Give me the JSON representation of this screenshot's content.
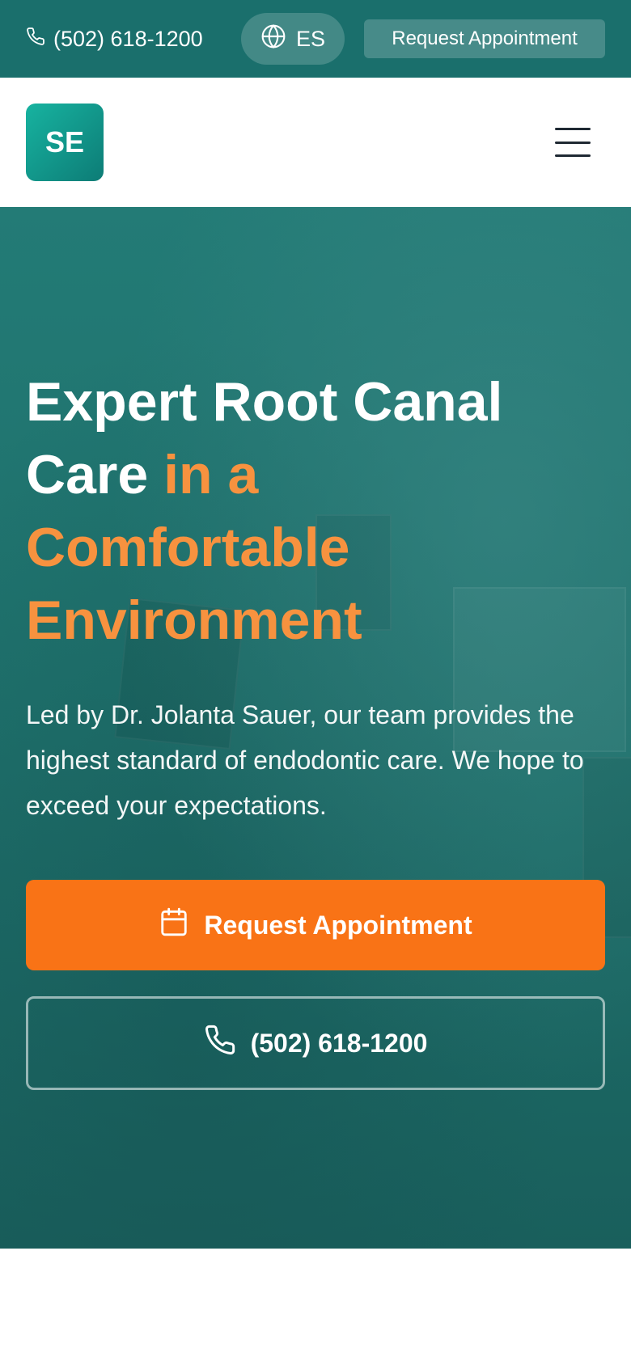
{
  "topbar": {
    "phone": "(502) 618-1200",
    "language_label": "ES",
    "cta_label": "Request Appointment"
  },
  "header": {
    "logo_text": "SE"
  },
  "hero": {
    "title_main": "Expert Root Canal Care",
    "title_accent": "in a Comfortable Environment",
    "subtitle": "Led by Dr. Jolanta Sauer, our team provides the highest standard of endodontic care. We hope to exceed your expectations.",
    "primary_cta_label": "Request Appointment",
    "secondary_cta_label": "(502) 618-1200"
  },
  "icons": {
    "phone": "phone-icon",
    "globe": "globe-icon",
    "calendar": "calendar-icon",
    "menu": "menu-icon"
  },
  "colors": {
    "brand_teal": "#1a6f6c",
    "accent_orange": "#f97316",
    "accent_text_orange": "#f7923f"
  }
}
